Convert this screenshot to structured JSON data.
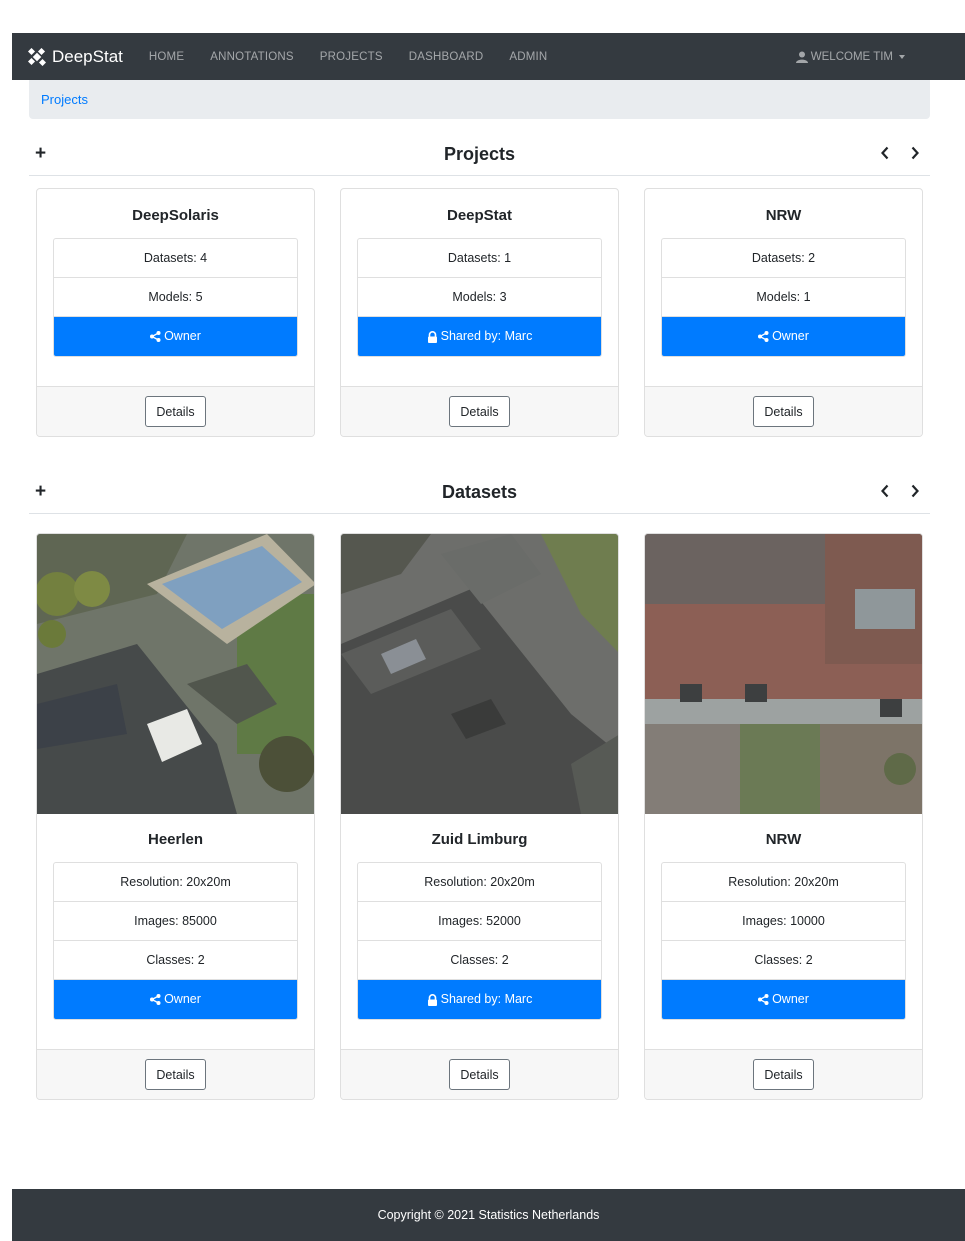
{
  "navbar": {
    "brand": "DeepStat",
    "links": [
      "HOME",
      "ANNOTATIONS",
      "PROJECTS",
      "DASHBOARD",
      "ADMIN"
    ],
    "user": "WELCOME TIM"
  },
  "breadcrumb": "Projects",
  "projects": {
    "title": "Projects",
    "add": "+",
    "items": [
      {
        "name": "DeepSolaris",
        "datasets": "Datasets: 4",
        "models": "Models: 5",
        "access": "Owner",
        "access_icon": "share-icon",
        "details": "Details"
      },
      {
        "name": "DeepStat",
        "datasets": "Datasets: 1",
        "models": "Models: 3",
        "access": "Shared by: Marc",
        "access_icon": "lock-icon",
        "details": "Details"
      },
      {
        "name": "NRW",
        "datasets": "Datasets: 2",
        "models": "Models: 1",
        "access": "Owner",
        "access_icon": "share-icon",
        "details": "Details"
      }
    ]
  },
  "datasets": {
    "title": "Datasets",
    "add": "+",
    "items": [
      {
        "name": "Heerlen",
        "resolution": "Resolution: 20x20m",
        "images": "Images: 85000",
        "classes": "Classes: 2",
        "access": "Owner",
        "access_icon": "share-icon",
        "details": "Details"
      },
      {
        "name": "Zuid Limburg",
        "resolution": "Resolution: 20x20m",
        "images": "Images: 52000",
        "classes": "Classes: 2",
        "access": "Shared by: Marc",
        "access_icon": "lock-icon",
        "details": "Details"
      },
      {
        "name": "NRW",
        "resolution": "Resolution: 20x20m",
        "images": "Images: 10000",
        "classes": "Classes: 2",
        "access": "Owner",
        "access_icon": "share-icon",
        "details": "Details"
      }
    ]
  },
  "footer": "Copyright © 2021 Statistics Netherlands",
  "colors": {
    "navbar": "#343a40",
    "primary": "#007bff",
    "breadcrumb_bg": "#e9ecef"
  }
}
